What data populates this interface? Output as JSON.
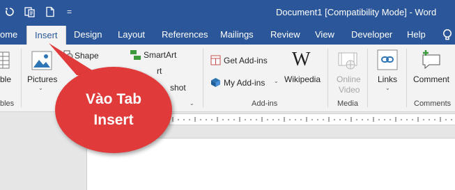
{
  "titlebar": {
    "title": "Document1 [Compatibility Mode]  -  Word",
    "qa_icons": [
      "undo-icon",
      "touch-mode-icon",
      "new-document-icon",
      "customize-qat-icon"
    ],
    "customize_glyph": "="
  },
  "tabs": [
    {
      "label": "ome"
    },
    {
      "label": "Insert",
      "active": true
    },
    {
      "label": "Design"
    },
    {
      "label": "Layout"
    },
    {
      "label": "References"
    },
    {
      "label": "Mailings"
    },
    {
      "label": "Review"
    },
    {
      "label": "View"
    },
    {
      "label": "Developer"
    },
    {
      "label": "Help"
    }
  ],
  "ribbon": {
    "table_partial": "ble",
    "tables_group_partial": "bles",
    "pictures": "Pictures",
    "shapes_partial": "Shape",
    "smartart": "SmartArt",
    "chart_partial": "rt",
    "screenshot_partial": "shot",
    "get_addins": "Get Add-ins",
    "my_addins": "My Add-ins",
    "wikipedia": "Wikipedia",
    "wikipedia_glyph": "W",
    "online_video_1": "Online",
    "online_video_2": "Video",
    "links": "Links",
    "comment": "Comment",
    "groups": {
      "addins": "Add-ins",
      "media": "Media",
      "comments": "Comments"
    },
    "caret": "⌄"
  },
  "callout": {
    "line1": "Vào Tab",
    "line2": "Insert",
    "color": "#e03a3a"
  },
  "colors": {
    "accent": "#2b579a"
  }
}
